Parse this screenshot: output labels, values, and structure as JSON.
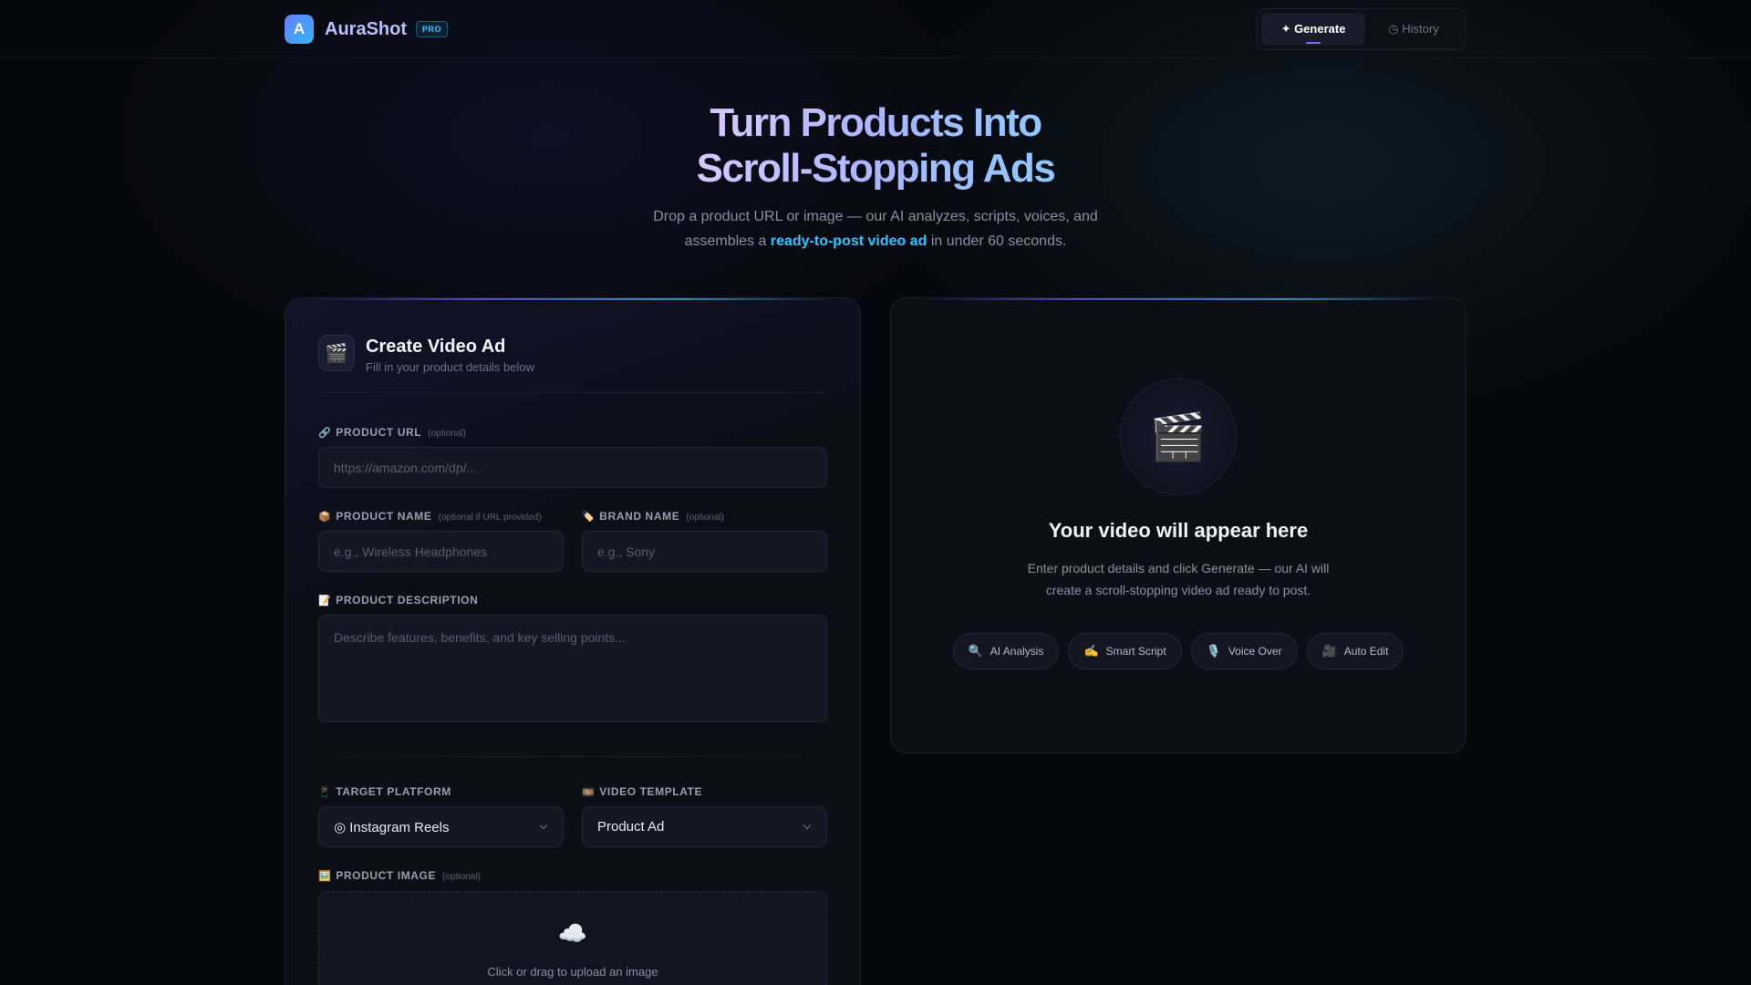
{
  "app": {
    "logo_letter": "A",
    "name": "AuraShot",
    "badge": "PRO"
  },
  "nav": {
    "generate": "✦ Generate",
    "history": "◷ History"
  },
  "hero": {
    "title_line1": "Turn Products Into",
    "title_line2": "Scroll-Stopping Ads",
    "sub_line1": "Drop a product URL or image — our AI analyzes, scripts, voices, and",
    "sub_line2_pre": "assembles a ",
    "sub_line2_highlight": "ready-to-post video ad",
    "sub_line2_post": " in under 60 seconds."
  },
  "form": {
    "icon": "🎬",
    "title": "Create Video Ad",
    "subtitle": "Fill in your product details below",
    "product_url": {
      "icon": "🔗",
      "label": "PRODUCT URL",
      "optional": "(optional)",
      "placeholder": "https://amazon.com/dp/..."
    },
    "product_name": {
      "icon": "📦",
      "label": "PRODUCT NAME",
      "optional": "(optional if URL provided)",
      "placeholder": "e.g., Wireless Headphones"
    },
    "brand_name": {
      "icon": "🏷️",
      "label": "BRAND NAME",
      "optional": "(optional)",
      "placeholder": "e.g., Sony"
    },
    "description": {
      "icon": "📝",
      "label": "PRODUCT DESCRIPTION",
      "placeholder": "Describe features, benefits, and key selling points..."
    },
    "platform": {
      "icon": "📱",
      "label": "TARGET PLATFORM",
      "value": "◎ Instagram Reels"
    },
    "template": {
      "icon": "🎞️",
      "label": "VIDEO TEMPLATE",
      "value": "Product Ad"
    },
    "image": {
      "icon": "🖼️",
      "label": "PRODUCT IMAGE",
      "optional": "(optional)",
      "upload_icon": "☁️",
      "upload_text": "Click or drag to upload an image"
    }
  },
  "preview": {
    "icon": "🎬",
    "title": "Your video will appear here",
    "desc_line1": "Enter product details and click Generate — our AI will",
    "desc_line2": "create a scroll-stopping video ad ready to post.",
    "chips": [
      {
        "icon": "🔍",
        "label": "AI Analysis"
      },
      {
        "icon": "✍️",
        "label": "Smart Script"
      },
      {
        "icon": "🎙️",
        "label": "Voice Over"
      },
      {
        "icon": "🎥",
        "label": "Auto Edit"
      }
    ]
  }
}
